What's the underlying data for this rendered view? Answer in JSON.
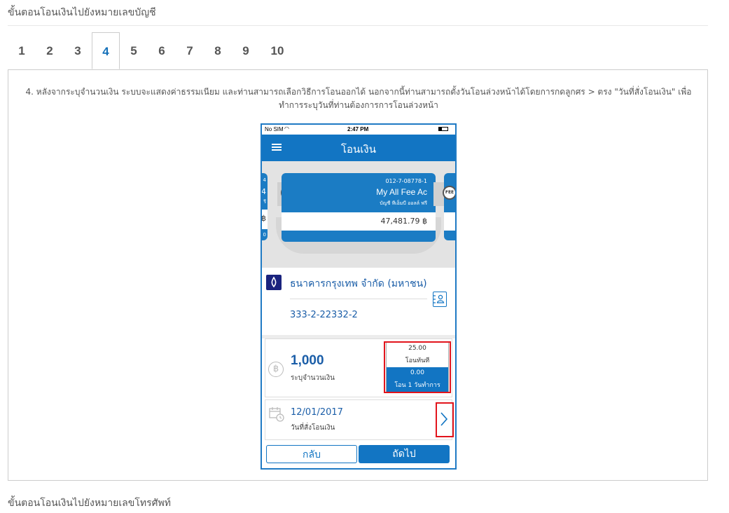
{
  "section_top_title": "ขั้นตอนโอนเงินไปยังหมายเลขบัญชี",
  "section_bottom_title": "ขั้นตอนโอนเงินไปยังหมายเลขโทรศัพท์",
  "tabs": [
    "1",
    "2",
    "3",
    "4",
    "5",
    "6",
    "7",
    "8",
    "9",
    "10"
  ],
  "active_tab": "4",
  "description": "4. หลังจากระบุจำนวนเงิน ระบบจะแสดงค่าธรรมเนียม และท่านสามารถเลือกวิธีการโอนออกได้ นอกจากนี้ท่านสามารถตั้งวันโอนล่วงหน้าได้โดยการกดลูกศร > ตรง \"วันที่สั่งโอนเงิน\" เพื่อทำการระบุวันที่ท่านต้องการการโอนล่วงหน้า",
  "phone": {
    "status": {
      "carrier": "No SIM",
      "time": "2:47 PM"
    },
    "appbar_title": "โอนเงิน",
    "card": {
      "account_no": "012-7-08778-1",
      "name": "My All Fee Ac",
      "subtitle": "บัญชี ทีเอ็มบี ออลล์ ฟรี",
      "balance": "47,481.79 ฿",
      "badge": "FEE"
    },
    "left_card_fragments": [
      "4",
      "4",
      "รี",
      "฿",
      "0"
    ],
    "bank_name": "ธนาคารกรุงเทพ จำกัด (มหาชน)",
    "bank_account": "333-2-22332-2",
    "amount": "1,000",
    "amount_label": "ระบุจำนวนเงิน",
    "fee_option_1_amount": "25.00",
    "fee_option_1_label": "โอนทันที",
    "fee_option_2_amount": "0.00",
    "fee_option_2_label": "โอน 1 วันทำการ",
    "date": "12/01/2017",
    "date_label": "วันที่สั่งโอนเงิน",
    "back_button": "กลับ",
    "next_button": "ถัดไป"
  },
  "colors": {
    "brand_blue": "#1275c3",
    "highlight_red": "#e2141c",
    "tab_active_text": "#1470b9"
  }
}
